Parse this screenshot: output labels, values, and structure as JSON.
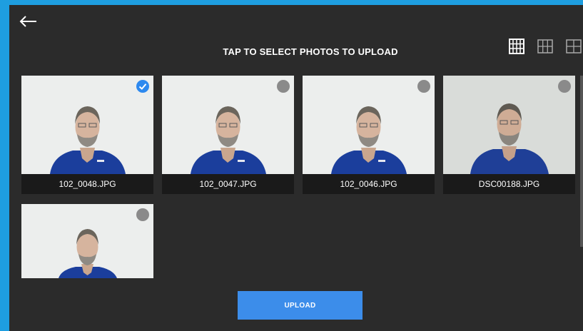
{
  "header": {
    "back_icon": "arrow-left-icon",
    "title": "TAP TO SELECT PHOTOS TO UPLOAD",
    "view_icons": [
      "grid-small-icon",
      "grid-medium-icon",
      "grid-large-icon"
    ]
  },
  "photos": [
    {
      "filename": "102_0048.JPG",
      "selected": true
    },
    {
      "filename": "102_0047.JPG",
      "selected": false
    },
    {
      "filename": "102_0046.JPG",
      "selected": false
    },
    {
      "filename": "DSC00188.JPG",
      "selected": false
    },
    {
      "filename": "",
      "selected": false
    }
  ],
  "upload_label": "UPLOAD",
  "colors": {
    "accent": "#3c8dea",
    "window_border": "#1e9ee0",
    "background": "#2b2b2b",
    "check_selected": "#2d89ef",
    "check_unselected": "#8a8a8a"
  }
}
